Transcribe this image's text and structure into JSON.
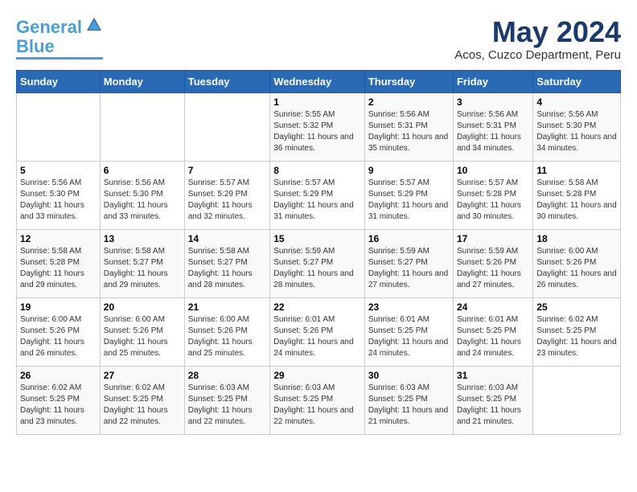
{
  "header": {
    "logo_line1": "General",
    "logo_line2": "Blue",
    "month_title": "May 2024",
    "location": "Acos, Cuzco Department, Peru"
  },
  "weekdays": [
    "Sunday",
    "Monday",
    "Tuesday",
    "Wednesday",
    "Thursday",
    "Friday",
    "Saturday"
  ],
  "weeks": [
    [
      {
        "day": "",
        "info": ""
      },
      {
        "day": "",
        "info": ""
      },
      {
        "day": "",
        "info": ""
      },
      {
        "day": "1",
        "info": "Sunrise: 5:55 AM\nSunset: 5:32 PM\nDaylight: 11 hours and 36 minutes."
      },
      {
        "day": "2",
        "info": "Sunrise: 5:56 AM\nSunset: 5:31 PM\nDaylight: 11 hours and 35 minutes."
      },
      {
        "day": "3",
        "info": "Sunrise: 5:56 AM\nSunset: 5:31 PM\nDaylight: 11 hours and 34 minutes."
      },
      {
        "day": "4",
        "info": "Sunrise: 5:56 AM\nSunset: 5:30 PM\nDaylight: 11 hours and 34 minutes."
      }
    ],
    [
      {
        "day": "5",
        "info": "Sunrise: 5:56 AM\nSunset: 5:30 PM\nDaylight: 11 hours and 33 minutes."
      },
      {
        "day": "6",
        "info": "Sunrise: 5:56 AM\nSunset: 5:30 PM\nDaylight: 11 hours and 33 minutes."
      },
      {
        "day": "7",
        "info": "Sunrise: 5:57 AM\nSunset: 5:29 PM\nDaylight: 11 hours and 32 minutes."
      },
      {
        "day": "8",
        "info": "Sunrise: 5:57 AM\nSunset: 5:29 PM\nDaylight: 11 hours and 31 minutes."
      },
      {
        "day": "9",
        "info": "Sunrise: 5:57 AM\nSunset: 5:29 PM\nDaylight: 11 hours and 31 minutes."
      },
      {
        "day": "10",
        "info": "Sunrise: 5:57 AM\nSunset: 5:28 PM\nDaylight: 11 hours and 30 minutes."
      },
      {
        "day": "11",
        "info": "Sunrise: 5:58 AM\nSunset: 5:28 PM\nDaylight: 11 hours and 30 minutes."
      }
    ],
    [
      {
        "day": "12",
        "info": "Sunrise: 5:58 AM\nSunset: 5:28 PM\nDaylight: 11 hours and 29 minutes."
      },
      {
        "day": "13",
        "info": "Sunrise: 5:58 AM\nSunset: 5:27 PM\nDaylight: 11 hours and 29 minutes."
      },
      {
        "day": "14",
        "info": "Sunrise: 5:58 AM\nSunset: 5:27 PM\nDaylight: 11 hours and 28 minutes."
      },
      {
        "day": "15",
        "info": "Sunrise: 5:59 AM\nSunset: 5:27 PM\nDaylight: 11 hours and 28 minutes."
      },
      {
        "day": "16",
        "info": "Sunrise: 5:59 AM\nSunset: 5:27 PM\nDaylight: 11 hours and 27 minutes."
      },
      {
        "day": "17",
        "info": "Sunrise: 5:59 AM\nSunset: 5:26 PM\nDaylight: 11 hours and 27 minutes."
      },
      {
        "day": "18",
        "info": "Sunrise: 6:00 AM\nSunset: 5:26 PM\nDaylight: 11 hours and 26 minutes."
      }
    ],
    [
      {
        "day": "19",
        "info": "Sunrise: 6:00 AM\nSunset: 5:26 PM\nDaylight: 11 hours and 26 minutes."
      },
      {
        "day": "20",
        "info": "Sunrise: 6:00 AM\nSunset: 5:26 PM\nDaylight: 11 hours and 25 minutes."
      },
      {
        "day": "21",
        "info": "Sunrise: 6:00 AM\nSunset: 5:26 PM\nDaylight: 11 hours and 25 minutes."
      },
      {
        "day": "22",
        "info": "Sunrise: 6:01 AM\nSunset: 5:26 PM\nDaylight: 11 hours and 24 minutes."
      },
      {
        "day": "23",
        "info": "Sunrise: 6:01 AM\nSunset: 5:25 PM\nDaylight: 11 hours and 24 minutes."
      },
      {
        "day": "24",
        "info": "Sunrise: 6:01 AM\nSunset: 5:25 PM\nDaylight: 11 hours and 24 minutes."
      },
      {
        "day": "25",
        "info": "Sunrise: 6:02 AM\nSunset: 5:25 PM\nDaylight: 11 hours and 23 minutes."
      }
    ],
    [
      {
        "day": "26",
        "info": "Sunrise: 6:02 AM\nSunset: 5:25 PM\nDaylight: 11 hours and 23 minutes."
      },
      {
        "day": "27",
        "info": "Sunrise: 6:02 AM\nSunset: 5:25 PM\nDaylight: 11 hours and 22 minutes."
      },
      {
        "day": "28",
        "info": "Sunrise: 6:03 AM\nSunset: 5:25 PM\nDaylight: 11 hours and 22 minutes."
      },
      {
        "day": "29",
        "info": "Sunrise: 6:03 AM\nSunset: 5:25 PM\nDaylight: 11 hours and 22 minutes."
      },
      {
        "day": "30",
        "info": "Sunrise: 6:03 AM\nSunset: 5:25 PM\nDaylight: 11 hours and 21 minutes."
      },
      {
        "day": "31",
        "info": "Sunrise: 6:03 AM\nSunset: 5:25 PM\nDaylight: 11 hours and 21 minutes."
      },
      {
        "day": "",
        "info": ""
      }
    ]
  ]
}
